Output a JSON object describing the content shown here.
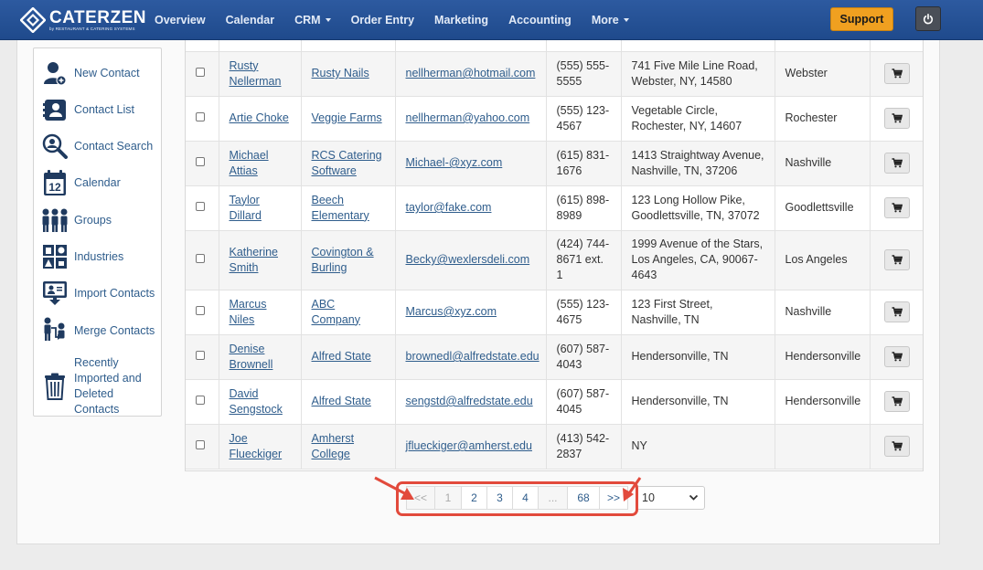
{
  "brand": {
    "name": "CATERZEN",
    "tagline": "by RESTAURANT & CATERING SYSTEMS"
  },
  "nav": {
    "items": [
      {
        "label": "Overview",
        "dropdown": false
      },
      {
        "label": "Calendar",
        "dropdown": false
      },
      {
        "label": "CRM",
        "dropdown": true
      },
      {
        "label": "Order Entry",
        "dropdown": false
      },
      {
        "label": "Marketing",
        "dropdown": false
      },
      {
        "label": "Accounting",
        "dropdown": false
      },
      {
        "label": "More",
        "dropdown": true
      }
    ],
    "support_label": "Support",
    "power_icon": "power-icon"
  },
  "sidebar": {
    "items": [
      {
        "label": "New Contact",
        "icon": "new-contact-icon"
      },
      {
        "label": "Contact List",
        "icon": "contact-list-icon"
      },
      {
        "label": "Contact Search",
        "icon": "contact-search-icon"
      },
      {
        "label": "Calendar",
        "icon": "calendar-icon",
        "icon_text": "12"
      },
      {
        "label": "Groups",
        "icon": "groups-icon"
      },
      {
        "label": "Industries",
        "icon": "industries-icon"
      },
      {
        "label": "Import Contacts",
        "icon": "import-icon"
      },
      {
        "label": "Merge Contacts",
        "icon": "merge-icon"
      },
      {
        "label": "Recently Imported and Deleted Contacts",
        "icon": "trash-icon"
      }
    ]
  },
  "table": {
    "rows": [
      {
        "name": "Rusty Nellerman",
        "company": "Rusty Nails",
        "email": "nellherman@hotmail.com",
        "phone": "(555) 555-5555",
        "address": "741 Five Mile Line Road, Webster, NY, 14580",
        "city": "Webster"
      },
      {
        "name": "Artie Choke",
        "company": "Veggie Farms",
        "email": "nellherman@yahoo.com",
        "phone": "(555) 123-4567",
        "address": "Vegetable Circle, Rochester, NY, 14607",
        "city": "Rochester"
      },
      {
        "name": "Michael Attias",
        "company": "RCS Catering Software",
        "email": "Michael-@xyz.com",
        "phone": "(615) 831-1676",
        "address": "1413 Straightway Avenue, Nashville, TN, 37206",
        "city": "Nashville"
      },
      {
        "name": "Taylor Dillard",
        "company": "Beech Elementary",
        "email": "taylor@fake.com",
        "phone": "(615) 898-8989",
        "address": "123 Long Hollow Pike, Goodlettsville, TN, 37072",
        "city": "Goodlettsville"
      },
      {
        "name": "Katherine Smith",
        "company": "Covington & Burling",
        "email": "Becky@wexlersdeli.com",
        "phone": "(424) 744-8671 ext. 1",
        "address": "1999 Avenue of the Stars, Los Angeles, CA, 90067-4643",
        "city": "Los Angeles"
      },
      {
        "name": "Marcus Niles",
        "company": "ABC Company",
        "email": "Marcus@xyz.com",
        "phone": "(555) 123-4675",
        "address": "123 First Street, Nashville, TN",
        "city": "Nashville"
      },
      {
        "name": "Denise Brownell",
        "company": "Alfred State",
        "email": "brownedl@alfredstate.edu",
        "phone": "(607) 587-4043",
        "address": "Hendersonville, TN",
        "city": "Hendersonville"
      },
      {
        "name": "David Sengstock",
        "company": "Alfred State",
        "email": "sengstd@alfredstate.edu",
        "phone": "(607) 587-4045",
        "address": "Hendersonville, TN",
        "city": "Hendersonville"
      },
      {
        "name": "Joe Flueckiger",
        "company": "Amherst College",
        "email": "jflueckiger@amherst.edu",
        "phone": "(413) 542-2837",
        "address": "NY",
        "city": ""
      }
    ],
    "cart_icon": "cart-icon"
  },
  "pagination": {
    "prev": "<<",
    "pages": [
      "1",
      "2",
      "3",
      "4"
    ],
    "gap": "...",
    "last": "68",
    "next": ">>",
    "current": "1",
    "page_size": "10"
  },
  "annotation": {
    "color": "#e24a3c"
  }
}
